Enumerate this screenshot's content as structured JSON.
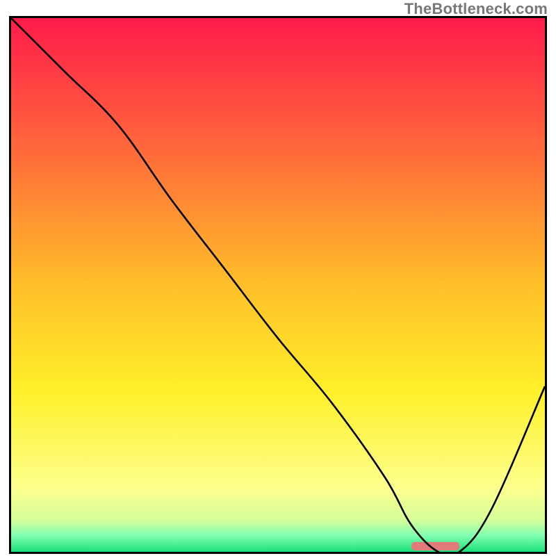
{
  "watermark": "TheBottleneck.com",
  "chart_data": {
    "type": "line",
    "title": "",
    "xlabel": "",
    "ylabel": "",
    "xlim": [
      0,
      100
    ],
    "ylim": [
      0,
      100
    ],
    "grid": false,
    "background_gradient": {
      "stops": [
        {
          "y_pct": 0,
          "color": "#ff1b4b"
        },
        {
          "y_pct": 25,
          "color": "#ff6a3a"
        },
        {
          "y_pct": 50,
          "color": "#ffbf2a"
        },
        {
          "y_pct": 70,
          "color": "#fff02a"
        },
        {
          "y_pct": 88,
          "color": "#fdff8c"
        },
        {
          "y_pct": 94,
          "color": "#d6ff9a"
        },
        {
          "y_pct": 97,
          "color": "#7fffb0"
        },
        {
          "y_pct": 100,
          "color": "#1be07a"
        }
      ]
    },
    "series": [
      {
        "name": "curve",
        "color": "#000000",
        "x": [
          0,
          10,
          20,
          30,
          40,
          50,
          60,
          70,
          75,
          80,
          84,
          90,
          100
        ],
        "values": [
          100,
          90,
          80,
          66,
          53,
          40,
          28,
          14,
          5,
          0,
          0,
          8,
          31
        ]
      }
    ],
    "highlight_bar": {
      "x_start_pct": 75,
      "x_end_pct": 84,
      "y_pct": 0,
      "color": "#e27a7a",
      "height_pct": 1.6
    }
  }
}
